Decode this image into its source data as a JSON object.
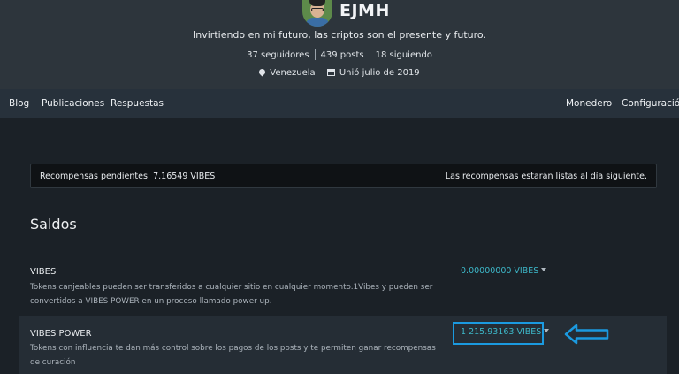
{
  "profile": {
    "username": "EJMH",
    "tagline": "Invirtiendo en mi futuro, las criptos son el presente y futuro.",
    "followers": "37 seguidores",
    "posts": "439 posts",
    "following": "18 siguiendo",
    "location": "Venezuela",
    "joined": "Unió julio de 2019"
  },
  "nav": {
    "left": [
      "Blog",
      "Publicaciones",
      "Respuestas"
    ],
    "right": [
      "Monedero",
      "Configuración"
    ]
  },
  "pending": {
    "left_text": "Recompensas pendientes: 7.16549 VIBES",
    "right_text": "Las recompensas estarán listas al día siguiente."
  },
  "balances": {
    "title": "Saldos",
    "items": [
      {
        "name": "VIBES",
        "description": "Tokens canjeables pueden ser transferidos a cualquier sitio en cualquier momento.1Vibes y pueden ser convertidos a VIBES POWER en un proceso llamado power up.",
        "value": "0.00000000 VIBES"
      },
      {
        "name": "VIBES POWER",
        "description": "Tokens con influencia te dan más control sobre los pagos de los posts y te permiten ganar recompensas de curación",
        "value": "1 215.93163 VIBES"
      }
    ]
  },
  "colors": {
    "accent_value": "#3db8c9",
    "highlight": "#1b9ae0"
  }
}
